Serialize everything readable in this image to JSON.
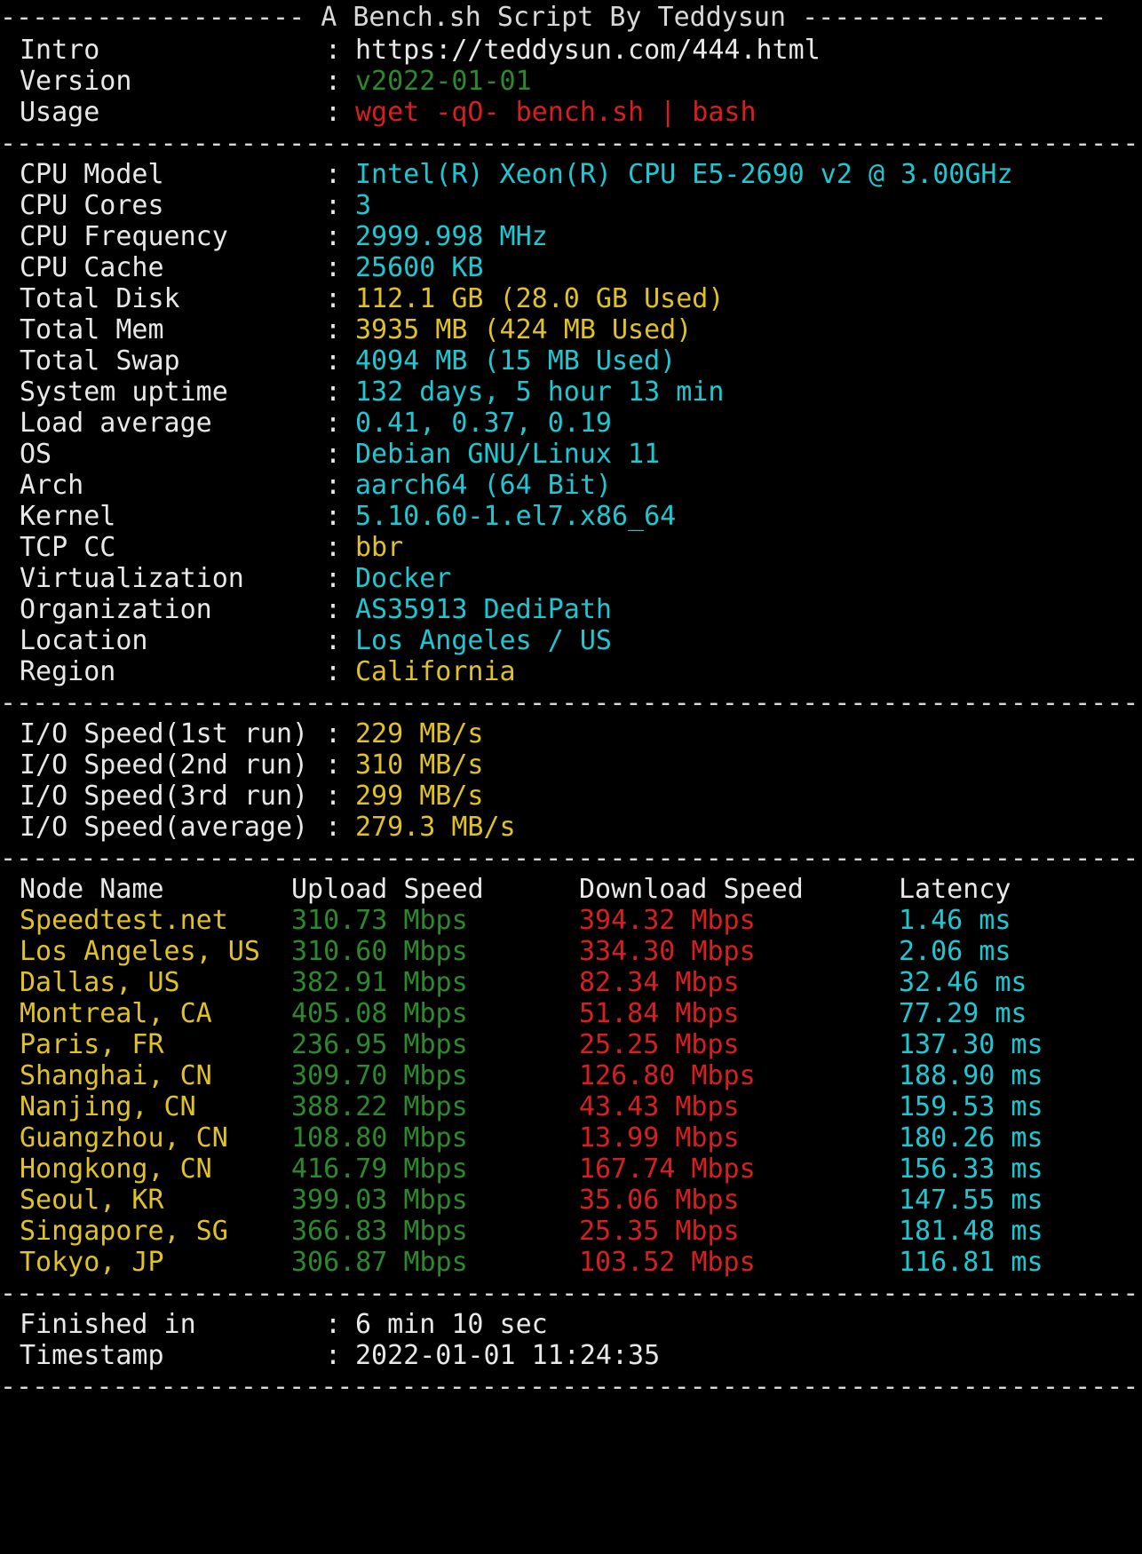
{
  "title": "A Bench.sh Script By Teddysun",
  "separator": "------------------------------------------------------------------------------------------------",
  "header": [
    {
      "key": "Intro",
      "value": "https://teddysun.com/444.html",
      "color": "#e8e8e8"
    },
    {
      "key": "Version",
      "value": "v2022-01-01",
      "color": "#2c8a2c"
    },
    {
      "key": "Usage",
      "value": "wget -qO- bench.sh | bash",
      "color": "#d81e1e"
    }
  ],
  "system": [
    {
      "key": "CPU Model",
      "value": "Intel(R) Xeon(R) CPU E5-2690 v2 @ 3.00GHz",
      "color": "#1ec8d2"
    },
    {
      "key": "CPU Cores",
      "value": "3",
      "color": "#1ec8d2"
    },
    {
      "key": "CPU Frequency",
      "value": "2999.998 MHz",
      "color": "#1ec8d2"
    },
    {
      "key": "CPU Cache",
      "value": "25600 KB",
      "color": "#1ec8d2"
    },
    {
      "key": "Total Disk",
      "value": "112.1 GB (28.0 GB Used)",
      "color": "#e1c224"
    },
    {
      "key": "Total Mem",
      "value": "3935 MB (424 MB Used)",
      "color": "#e1c224"
    },
    {
      "key": "Total Swap",
      "value": "4094 MB (15 MB Used)",
      "color": "#1ec8d2"
    },
    {
      "key": "System uptime",
      "value": "132 days, 5 hour 13 min",
      "color": "#1ec8d2"
    },
    {
      "key": "Load average",
      "value": "0.41, 0.37, 0.19",
      "color": "#1ec8d2"
    },
    {
      "key": "OS",
      "value": "Debian GNU/Linux 11",
      "color": "#1ec8d2"
    },
    {
      "key": "Arch",
      "value": "aarch64 (64 Bit)",
      "color": "#1ec8d2"
    },
    {
      "key": "Kernel",
      "value": "5.10.60-1.el7.x86_64",
      "color": "#1ec8d2"
    },
    {
      "key": "TCP CC",
      "value": "bbr",
      "color": "#e1c224"
    },
    {
      "key": "Virtualization",
      "value": "Docker",
      "color": "#1ec8d2"
    },
    {
      "key": "Organization",
      "value": "AS35913 DediPath",
      "color": "#1ec8d2"
    },
    {
      "key": "Location",
      "value": "Los Angeles / US",
      "color": "#1ec8d2"
    },
    {
      "key": "Region",
      "value": "California",
      "color": "#e1c224"
    }
  ],
  "io": [
    {
      "key": "I/O Speed(1st run)",
      "value": "229 MB/s"
    },
    {
      "key": "I/O Speed(2nd run)",
      "value": "310 MB/s"
    },
    {
      "key": "I/O Speed(3rd run)",
      "value": "299 MB/s"
    },
    {
      "key": "I/O Speed(average)",
      "value": "279.3 MB/s"
    }
  ],
  "speed_headers": [
    "Node Name",
    "Upload Speed",
    "Download Speed",
    "Latency"
  ],
  "speed_rows": [
    [
      "Speedtest.net",
      "310.73 Mbps",
      "394.32 Mbps",
      "1.46 ms"
    ],
    [
      "Los Angeles, US",
      "310.60 Mbps",
      "334.30 Mbps",
      "2.06 ms"
    ],
    [
      "Dallas, US",
      "382.91 Mbps",
      "82.34 Mbps",
      "32.46 ms"
    ],
    [
      "Montreal, CA",
      "405.08 Mbps",
      "51.84 Mbps",
      "77.29 ms"
    ],
    [
      "Paris, FR",
      "236.95 Mbps",
      "25.25 Mbps",
      "137.30 ms"
    ],
    [
      "Shanghai, CN",
      "309.70 Mbps",
      "126.80 Mbps",
      "188.90 ms"
    ],
    [
      "Nanjing, CN",
      "388.22 Mbps",
      "43.43 Mbps",
      "159.53 ms"
    ],
    [
      "Guangzhou, CN",
      "108.80 Mbps",
      "13.99 Mbps",
      "180.26 ms"
    ],
    [
      "Hongkong, CN",
      "416.79 Mbps",
      "167.74 Mbps",
      "156.33 ms"
    ],
    [
      "Seoul, KR",
      "399.03 Mbps",
      "35.06 Mbps",
      "147.55 ms"
    ],
    [
      "Singapore, SG",
      "366.83 Mbps",
      "25.35 Mbps",
      "181.48 ms"
    ],
    [
      "Tokyo, JP",
      "306.87 Mbps",
      "103.52 Mbps",
      "116.81 ms"
    ]
  ],
  "footer": [
    {
      "key": "Finished in",
      "value": "6 min 10 sec"
    },
    {
      "key": "Timestamp",
      "value": "2022-01-01 11:24:35"
    }
  ],
  "colors": {
    "background": "#000000",
    "text": "#e8e8e8",
    "cyan": "#1ec8d2",
    "yellow": "#e1c224",
    "green": "#2c8a2c",
    "red": "#d81e1e"
  }
}
